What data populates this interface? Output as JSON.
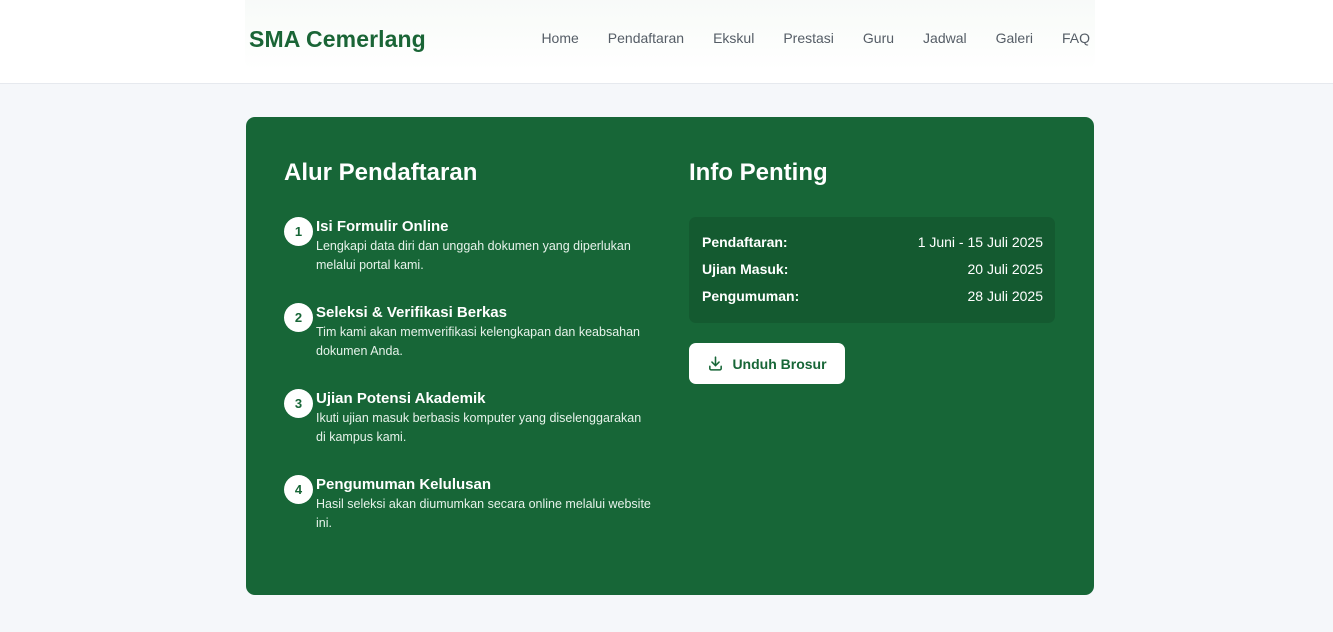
{
  "header": {
    "brand": "SMA Cemerlang",
    "nav": [
      "Home",
      "Pendaftaran",
      "Ekskul",
      "Prestasi",
      "Guru",
      "Jadwal",
      "Galeri",
      "FAQ"
    ]
  },
  "alur": {
    "title": "Alur Pendaftaran",
    "steps": [
      {
        "num": "1",
        "title": "Isi Formulir Online",
        "desc": "Lengkapi data diri dan unggah dokumen yang diperlukan melalui portal kami."
      },
      {
        "num": "2",
        "title": "Seleksi & Verifikasi Berkas",
        "desc": "Tim kami akan memverifikasi kelengkapan dan keabsahan dokumen Anda."
      },
      {
        "num": "3",
        "title": "Ujian Potensi Akademik",
        "desc": "Ikuti ujian masuk berbasis komputer yang diselenggarakan di kampus kami."
      },
      {
        "num": "4",
        "title": "Pengumuman Kelulusan",
        "desc": "Hasil seleksi akan diumumkan secara online melalui website ini."
      }
    ]
  },
  "info": {
    "title": "Info Penting",
    "rows": [
      {
        "label": "Pendaftaran:",
        "value": "1 Juni - 15 Juli 2025"
      },
      {
        "label": "Ujian Masuk:",
        "value": "20 Juli 2025"
      },
      {
        "label": "Pengumuman:",
        "value": "28 Juli 2025"
      }
    ],
    "button_label": "Unduh Brosur",
    "button_icon": "download-icon"
  },
  "colors": {
    "brand_green": "#176637",
    "info_box": "#145a30",
    "page_bg": "#f5f7fa"
  }
}
